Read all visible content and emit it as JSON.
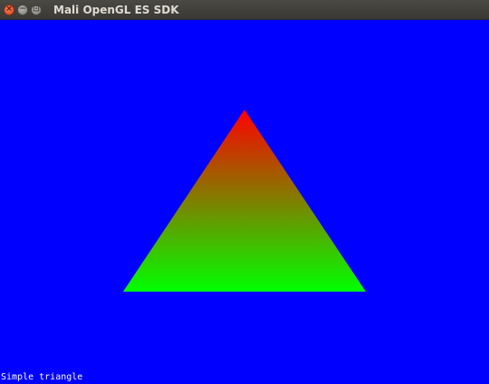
{
  "window": {
    "title": "Mali OpenGL ES SDK",
    "buttons": {
      "close": "×",
      "minimize": "−",
      "maximize": "⊡"
    }
  },
  "scene": {
    "clear_color": "#0000ff",
    "triangle": {
      "top_color": "#ff0000",
      "bottom_color": "#00ff00"
    }
  },
  "status": {
    "text": "Simple triangle"
  }
}
